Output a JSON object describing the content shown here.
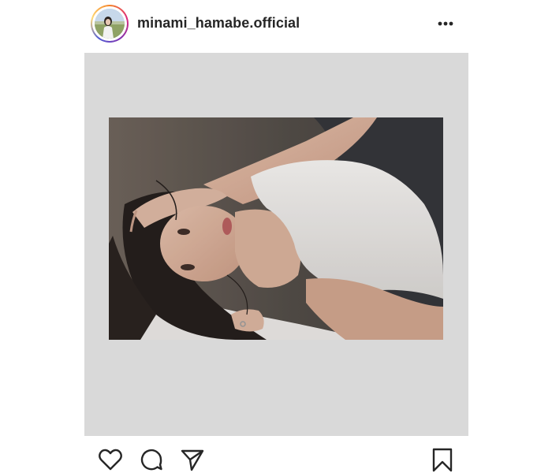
{
  "post": {
    "username": "minami_hamabe.official",
    "avatar_icon": "profile-avatar",
    "more_icon": "more-options-icon",
    "photo_description_icon": "post-photo"
  },
  "actions": {
    "like_icon": "heart-icon",
    "comment_icon": "comment-icon",
    "share_icon": "paper-plane-icon",
    "save_icon": "bookmark-icon"
  },
  "colors": {
    "text": "#262626",
    "frame_background": "#d9d9d9",
    "story_ring_start": "#f58529",
    "story_ring_end": "#515bd4"
  }
}
